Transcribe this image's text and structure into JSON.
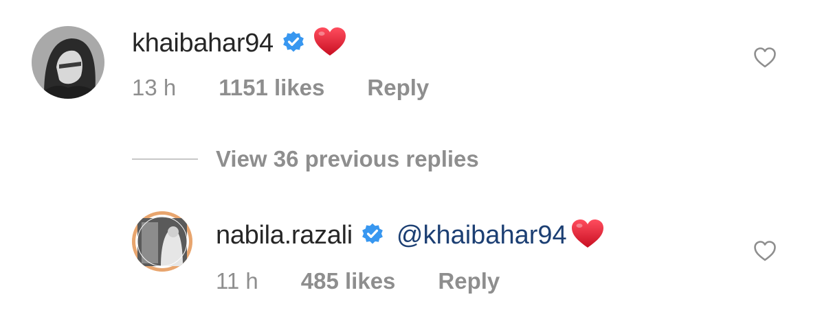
{
  "comments": [
    {
      "username": "khaibahar94",
      "verified_icon": "verified-badge-icon",
      "emoji_icon": "red-heart-emoji-icon",
      "mention": "",
      "time": "13 h",
      "likes": "1151 likes",
      "reply_label": "Reply",
      "like_icon": "heart-outline-icon"
    },
    {
      "username": "nabila.razali",
      "verified_icon": "verified-badge-icon",
      "emoji_icon": "red-heart-emoji-icon",
      "mention": "@khaibahar94",
      "time": "11 h",
      "likes": "485 likes",
      "reply_label": "Reply",
      "like_icon": "heart-outline-icon"
    }
  ],
  "view_replies": {
    "label": "View 36 previous replies"
  },
  "colors": {
    "username": "#262626",
    "meta": "#8e8e8e",
    "mention": "#1c3f73",
    "verified": "#3897f0",
    "heart_emoji": "#e0192d",
    "story_ring": "#e8a56e"
  }
}
